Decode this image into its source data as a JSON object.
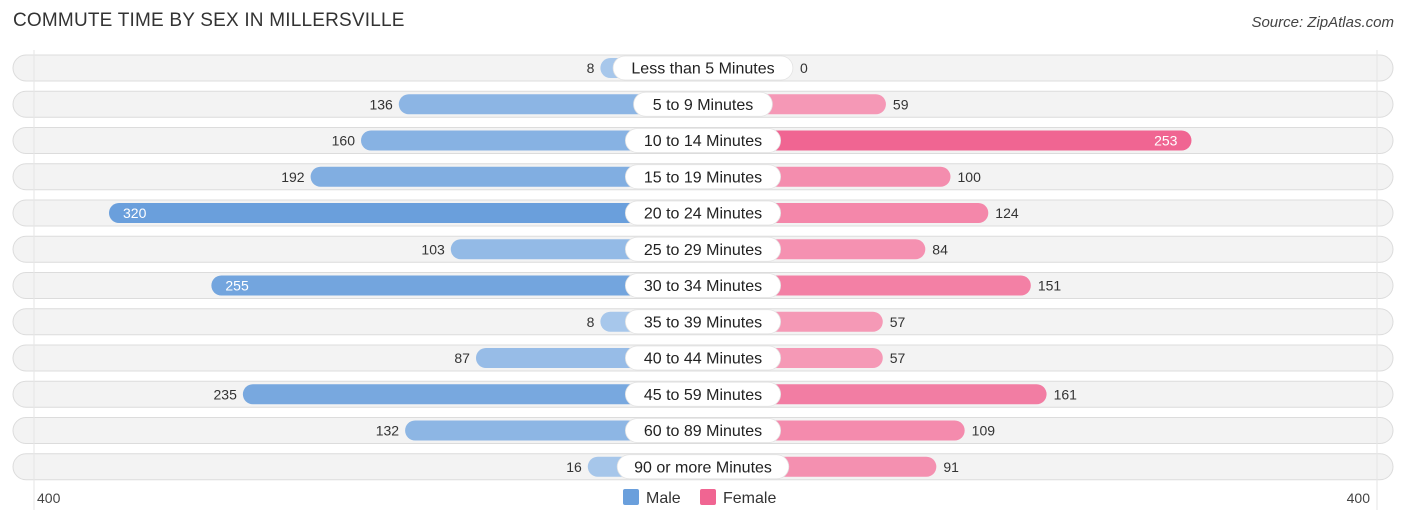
{
  "chart_data": {
    "type": "bar",
    "orientation": "horizontal-diverging",
    "title": "COMMUTE TIME BY SEX IN MILLERSVILLE",
    "source": "Source: ZipAtlas.com",
    "categories": [
      "Less than 5 Minutes",
      "5 to 9 Minutes",
      "10 to 14 Minutes",
      "15 to 19 Minutes",
      "20 to 24 Minutes",
      "25 to 29 Minutes",
      "30 to 34 Minutes",
      "35 to 39 Minutes",
      "40 to 44 Minutes",
      "45 to 59 Minutes",
      "60 to 89 Minutes",
      "90 or more Minutes"
    ],
    "series": [
      {
        "name": "Male",
        "side": "left",
        "color": "#6a9fdc",
        "color_light": "#a9c8eb",
        "values": [
          8,
          136,
          160,
          192,
          320,
          103,
          255,
          8,
          87,
          235,
          132,
          16
        ]
      },
      {
        "name": "Female",
        "side": "right",
        "color": "#f06592",
        "color_light": "#f7a8c1",
        "values": [
          0,
          59,
          253,
          100,
          124,
          84,
          151,
          57,
          57,
          161,
          109,
          91
        ]
      }
    ],
    "axis": {
      "left_label": "400",
      "right_label": "400",
      "max": 400
    },
    "legend": {
      "position": "bottom-center",
      "items": [
        "Male",
        "Female"
      ]
    },
    "grid": false
  }
}
